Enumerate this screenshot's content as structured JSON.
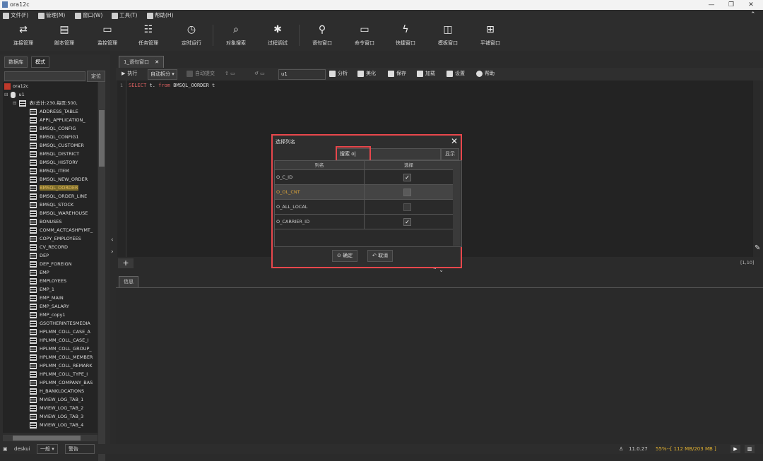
{
  "window": {
    "title": "ora12c",
    "minimize": "—",
    "restore": "❐",
    "close": "✕"
  },
  "menubar": [
    {
      "label": "文件(F)",
      "icon": "folder-icon"
    },
    {
      "label": "管理(M)",
      "icon": "gear-icon"
    },
    {
      "label": "窗口(W)",
      "icon": "windows-icon"
    },
    {
      "label": "工具(T)",
      "icon": "tools-icon"
    },
    {
      "label": "帮助(H)",
      "icon": "help-icon"
    }
  ],
  "toolbar": [
    {
      "label": "连接管理",
      "glyph": "⇄"
    },
    {
      "label": "脚本管理",
      "glyph": "▤"
    },
    {
      "label": "监控管理",
      "glyph": "▭"
    },
    {
      "label": "任务管理",
      "glyph": "☷"
    },
    {
      "label": "定时运行",
      "glyph": "◷"
    },
    {
      "label": "对象搜索",
      "glyph": "⌕"
    },
    {
      "label": "过程调试",
      "glyph": "✱"
    },
    {
      "label": "语句窗口",
      "glyph": "⚲"
    },
    {
      "label": "命令窗口",
      "glyph": "▭"
    },
    {
      "label": "快捷窗口",
      "glyph": "ϟ"
    },
    {
      "label": "模板窗口",
      "glyph": "◫"
    },
    {
      "label": "平铺窗口",
      "glyph": "⊞"
    }
  ],
  "left_panel": {
    "tabs": [
      "数据库",
      "模式"
    ],
    "locate_label": "定位",
    "tree_root": "ora12c",
    "tree_schema": "u1",
    "tree_table_group": "表(总计:230,每页:500,",
    "tables": [
      "ADDRESS_TABLE",
      "APPL_APPLICATION_",
      "BMSQL_CONFIG",
      "BMSQL_CONFIG1",
      "BMSQL_CUSTOMER",
      "BMSQL_DISTRICT",
      "BMSQL_HISTORY",
      "BMSQL_ITEM",
      "BMSQL_NEW_ORDER",
      "BMSQL_OORDER",
      "BMSQL_ORDER_LINE",
      "BMSQL_STOCK",
      "BMSQL_WAREHOUSE",
      "BONUSES",
      "COMM_ACTCASHPYMT_",
      "COPY_EMPLOYEES",
      "CV_RECORD",
      "DEP",
      "DEP_FOREIGN",
      "EMP",
      "EMPLOYEES",
      "EMP_1",
      "EMP_MAIN",
      "EMP_SALARY",
      "EMP_copy1",
      "GSOTHERINTESMEDIA",
      "HPLMM_COLL_CASE_A",
      "HPLMM_COLL_CASE_I",
      "HPLMM_COLL_GROUP_",
      "HPLMM_COLL_MEMBER",
      "HPLMM_COLL_REMARK",
      "HPLMM_COLL_TYPE_I",
      "HPLMM_COMPANY_BAS",
      "H_BANKLOCATIONS",
      "MVIEW_LOG_TAB_1",
      "MVIEW_LOG_TAB_2",
      "MVIEW_LOG_TAB_3",
      "MVIEW_LOG_TAB_4"
    ],
    "selected_table": "BMSQL_OORDER"
  },
  "editor": {
    "tab_label": "1_语句窗口",
    "toolbar": {
      "execute": "执行",
      "auto_split": "自动拆分",
      "auto_commit": "自动提交",
      "schema": "u1",
      "analyze": "分析",
      "beautify": "美化",
      "save": "保存",
      "load": "加载",
      "settings": "设置",
      "help": "帮助"
    },
    "line_number": "1",
    "code": {
      "kw1": "SELECT",
      "mid": " t. ",
      "kw2": "from",
      "rest": " BMSQL_OORDER t"
    },
    "cursor_pos": "[1,10]",
    "add_label": "+"
  },
  "info_panel": {
    "tab_label": "信息"
  },
  "status": {
    "user": "deskui",
    "level": "一般",
    "warn": "警告",
    "version": "11.0.27",
    "memory": "55%--[ 112 MB/203 MB ]"
  },
  "dialog": {
    "title": "选择列名",
    "search_label": "搜索",
    "search_value": "o",
    "show_label": "显示",
    "col_header": "列名",
    "sel_header": "选择",
    "rows": [
      {
        "name": "O_C_ID",
        "checked": true
      },
      {
        "name": "O_OL_CNT",
        "checked": false
      },
      {
        "name": "O_ALL_LOCAL",
        "checked": false
      },
      {
        "name": "O_CARRIER_ID",
        "checked": true
      }
    ],
    "ok_label": "确定",
    "cancel_label": "取消",
    "checkmark": "✓"
  }
}
